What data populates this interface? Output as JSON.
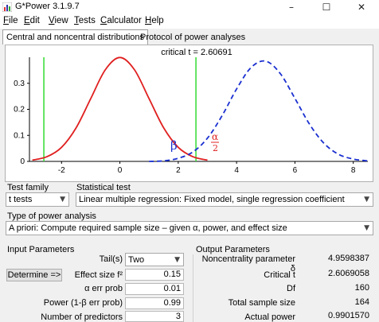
{
  "window": {
    "title": "G*Power 3.1.9.7",
    "minimize_glyph": "–",
    "maximize_glyph": "☐",
    "close_glyph": "✕"
  },
  "menu": {
    "items": [
      {
        "first": "F",
        "rest": "ile"
      },
      {
        "first": "E",
        "rest": "dit"
      },
      {
        "first": "V",
        "rest": "iew"
      },
      {
        "first": "T",
        "rest": "ests"
      },
      {
        "first": "C",
        "rest": "alculator"
      },
      {
        "first": "H",
        "rest": "elp"
      }
    ]
  },
  "tabs": {
    "central": "Central and noncentral distributions",
    "protocol": "Protocol of power analyses"
  },
  "plot": {
    "critical_label": "critical t = 2.60691",
    "beta_label": "β",
    "alpha_num": "α",
    "alpha_den": "2",
    "colors": {
      "null": "#e02020",
      "alt": "#1a2fd0",
      "critical": "#33dd33"
    }
  },
  "chart_data": {
    "type": "line",
    "title": "critical t = 2.60691",
    "xlim": [
      -3.1,
      8.5
    ],
    "ylim": [
      0,
      0.4
    ],
    "x_ticks": [
      -2,
      0,
      2,
      4,
      6,
      8
    ],
    "y_ticks": [
      0,
      0.1,
      0.2,
      0.3
    ],
    "x_tick_labels": [
      "-2",
      "0",
      "2",
      "4",
      "6",
      "8"
    ],
    "y_tick_labels": [
      "0",
      "0.1",
      "0.2",
      "0.3"
    ],
    "critical_values": [
      -2.60691,
      2.60691
    ],
    "series": [
      {
        "style": "solid",
        "color": "#e02020",
        "x": [
          -3,
          -2.5,
          -2,
          -1.5,
          -1,
          -0.5,
          0,
          0.5,
          1,
          1.5,
          2,
          2.5,
          3
        ],
        "y": [
          0.005,
          0.018,
          0.054,
          0.129,
          0.241,
          0.352,
          0.399,
          0.352,
          0.241,
          0.129,
          0.054,
          0.018,
          0.005
        ]
      },
      {
        "style": "dashed",
        "color": "#1a2fd0",
        "x": [
          1,
          1.5,
          2,
          2.5,
          3,
          3.5,
          4,
          4.5,
          5,
          5.5,
          6,
          6.5,
          7,
          7.5,
          8,
          8.5
        ],
        "y": [
          0.0,
          0.002,
          0.012,
          0.036,
          0.089,
          0.175,
          0.278,
          0.361,
          0.385,
          0.337,
          0.242,
          0.143,
          0.069,
          0.027,
          0.009,
          0.002
        ]
      }
    ]
  },
  "test_family": {
    "label": "Test family",
    "value": "t tests"
  },
  "statistical_test": {
    "label": "Statistical test",
    "value": "Linear multiple regression: Fixed model, single regression coefficient"
  },
  "power_analysis": {
    "label": "Type of power analysis",
    "value": "A priori: Compute required sample size – given α, power, and effect size"
  },
  "input": {
    "title": "Input Parameters",
    "determine": "Determine =>",
    "tails_label": "Tail(s)",
    "tails_value": "Two",
    "effect_label": "Effect size f²",
    "effect_value": "0.15",
    "alpha_label": "α err prob",
    "alpha_value": "0.01",
    "power_label": "Power (1-β err prob)",
    "power_value": "0.99",
    "predictors_label": "Number of predictors",
    "predictors_value": "3"
  },
  "output": {
    "title": "Output Parameters",
    "ncp_label": "Noncentrality parameter δ",
    "ncp_value": "4.9598387",
    "crit_label": "Critical t",
    "crit_value": "2.6069058",
    "df_label": "Df",
    "df_value": "160",
    "n_label": "Total sample size",
    "n_value": "164",
    "power_label": "Actual power",
    "power_value": "0.9901570"
  }
}
